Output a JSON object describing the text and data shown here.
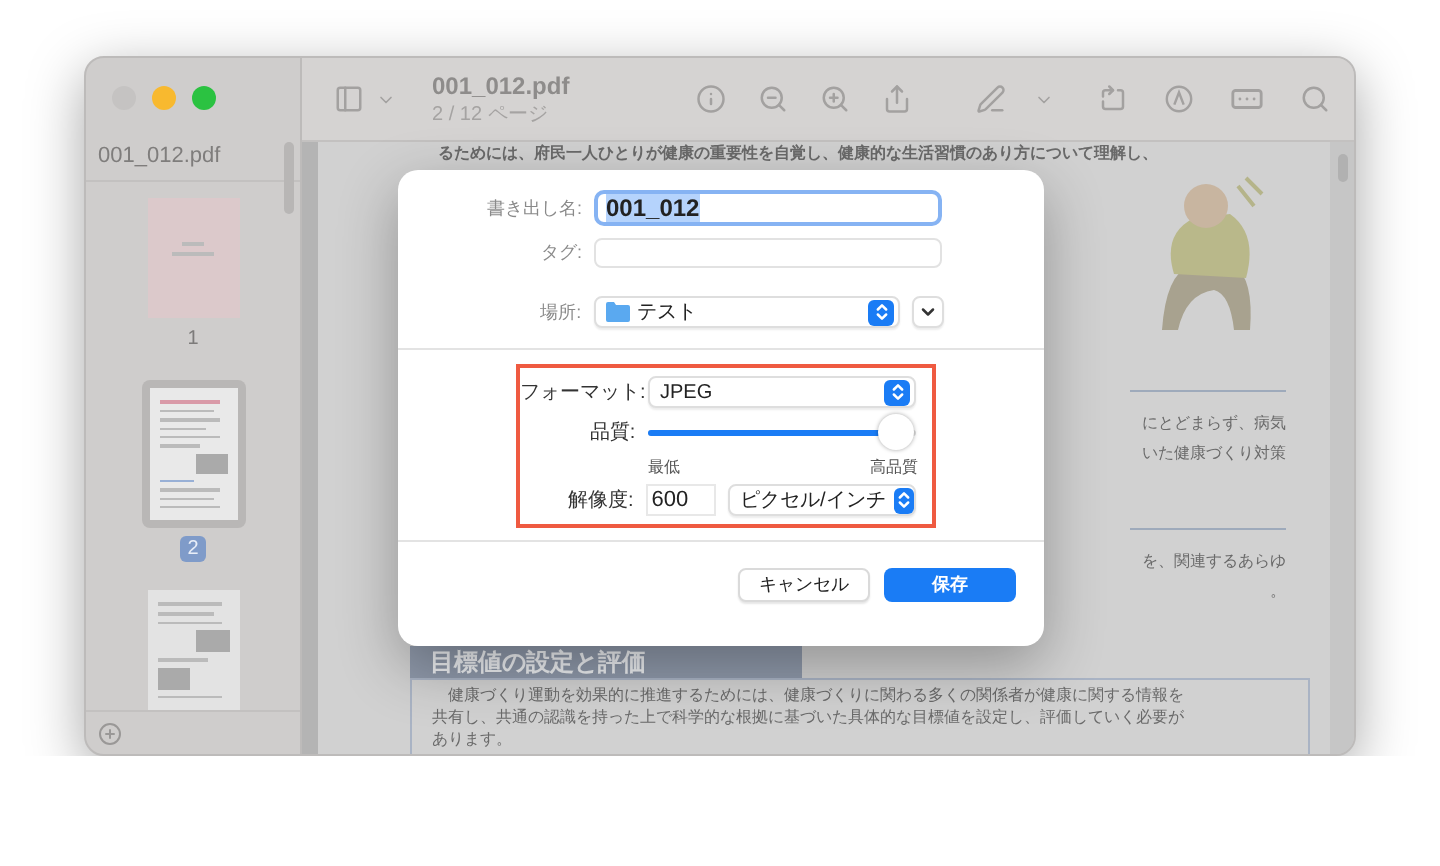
{
  "window": {
    "title": "001_012.pdf",
    "subtitle": "2 / 12 ページ",
    "traffic_lights": [
      {
        "kind": "close",
        "disabled": true
      },
      {
        "kind": "minimize",
        "disabled": false
      },
      {
        "kind": "zoom",
        "disabled": false
      }
    ]
  },
  "sidebar": {
    "title": "001_012.pdf",
    "thumbnails": [
      {
        "kind": "cover",
        "label": "1",
        "selected": false
      },
      {
        "kind": "text",
        "label": "2",
        "selected": true
      },
      {
        "kind": "photo",
        "selected": false
      }
    ]
  },
  "document": {
    "top_line": "るためには、府民一人ひとりが健康の重要性を自覚し、健康的な生活習慣のあり方について理解し、",
    "side_fragments": [
      {
        "kind": "rule"
      },
      {
        "kind": "text",
        "text": "にとどまらず、病気"
      },
      {
        "kind": "text",
        "text": "いた健康づくり対策"
      },
      {
        "kind": "rule"
      },
      {
        "kind": "text",
        "text": "を、関連するあらゆ"
      },
      {
        "kind": "text",
        "text": "。"
      }
    ],
    "heading": "目標値の設定と評価",
    "paragraph_lines": [
      "　健康づくり運動を効果的に推進するためには、健康づくりに関わる多くの関係者が健康に関する情報を",
      "共有し、共通の認識を持った上で科学的な根拠に基づいた具体的な目標値を設定し、評価していく必要が",
      "あります。"
    ]
  },
  "dialog": {
    "export_name": {
      "label": "書き出し名:",
      "value": "001_012",
      "text_selected": true
    },
    "tags": {
      "label": "タグ:"
    },
    "location": {
      "label": "場所:",
      "value": "テスト",
      "expanded": false
    },
    "options_highlighted": true,
    "format": {
      "label": "フォーマット:",
      "value": "JPEG"
    },
    "quality": {
      "label": "品質:",
      "level": 0.98,
      "min_label": "最低",
      "max_label": "高品質"
    },
    "resolution": {
      "label": "解像度:",
      "value": "600",
      "unit": "ピクセル/インチ"
    },
    "buttons": [
      {
        "kind": "cancel",
        "label": "キャンセル"
      },
      {
        "kind": "primary",
        "label": "保存"
      }
    ]
  }
}
